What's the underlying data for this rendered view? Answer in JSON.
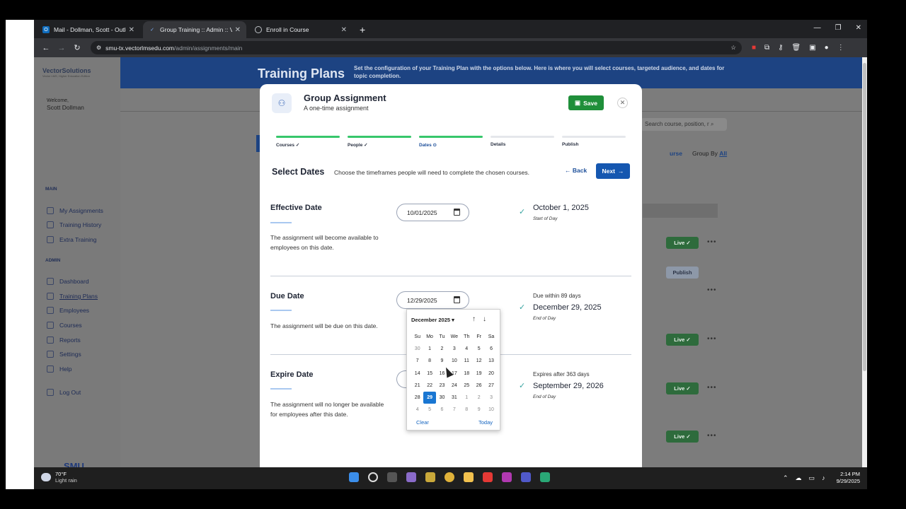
{
  "browser": {
    "tabs": [
      {
        "title": "Mail - Dollman, Scott - Outlook",
        "active": false
      },
      {
        "title": "Group Training :: Admin :: Vecto",
        "active": true
      },
      {
        "title": "Enroll in Course",
        "active": false
      }
    ],
    "url_domain": "smu-tx.vectorlmsedu.com",
    "url_path": "/admin/assignments/main"
  },
  "sidebar": {
    "logo": "VectorSolutions",
    "logo_sub": "Vector LMS, Higher Education Edition",
    "welcome": "Welcome,",
    "user": "Scott Dollman",
    "main_label": "MAIN",
    "main_items": [
      "My Assignments",
      "Training History",
      "Extra Training"
    ],
    "admin_label": "ADMIN",
    "admin_items": [
      "Dashboard",
      "Training Plans",
      "Employees",
      "Courses",
      "Reports",
      "Settings",
      "Help"
    ],
    "logout": "Log Out",
    "footer_logo": "SMU"
  },
  "banner": {
    "title": "Training Plans",
    "description": "Set the configuration of your Training Plan with the options below. Here is where you will select courses, targeted audience, and dates for topic completion."
  },
  "background": {
    "search_placeholder": "Search course, position, r",
    "sort_fragment": "urse",
    "group_by_label": "Group By",
    "group_by_value": "All",
    "badge_live": "Live ✓",
    "badge_publish": "Publish"
  },
  "modal": {
    "title": "Group Assignment",
    "subtitle": "A one-time assignment",
    "save_label": "Save",
    "steps": [
      {
        "label": "Courses ✓",
        "done": true
      },
      {
        "label": "People ✓",
        "done": true
      },
      {
        "label": "Dates ⊙",
        "done": true
      },
      {
        "label": "Details",
        "done": false
      },
      {
        "label": "Publish",
        "done": false
      }
    ],
    "section_title": "Select Dates",
    "section_desc": "Choose the timeframes people will need to complete the chosen courses.",
    "back_label": "Back",
    "next_label": "Next",
    "effective": {
      "title": "Effective Date",
      "desc": "The assignment will become available to employees on this date.",
      "input": "10/01/2025",
      "result": "October 1, 2025",
      "result_sub": "Start of Day"
    },
    "due": {
      "title": "Due Date",
      "desc": "The assignment will be due on this date.",
      "input": "12/29/2025",
      "result_pre": "Due within 89 days",
      "result": "December 29, 2025",
      "result_sub": "End of Day"
    },
    "expire": {
      "title": "Expire Date",
      "desc": "The assignment will no longer be available for employees after this date.",
      "result_pre": "Expires after 363 days",
      "result": "September 29, 2026",
      "result_sub": "End of Day"
    }
  },
  "calendar": {
    "month": "December 2025 ▾",
    "weekdays": [
      "Su",
      "Mo",
      "Tu",
      "We",
      "Th",
      "Fr",
      "Sa"
    ],
    "days": [
      "30",
      "1",
      "2",
      "3",
      "4",
      "5",
      "6",
      "7",
      "8",
      "9",
      "10",
      "11",
      "12",
      "13",
      "14",
      "15",
      "16",
      "17",
      "18",
      "19",
      "20",
      "21",
      "22",
      "23",
      "24",
      "25",
      "26",
      "27",
      "28",
      "29",
      "30",
      "31",
      "1",
      "2",
      "3",
      "4",
      "5",
      "6",
      "7",
      "8",
      "9",
      "10"
    ],
    "selected": "29",
    "clear_label": "Clear",
    "today_label": "Today"
  },
  "taskbar": {
    "temp": "70°F",
    "weather": "Light rain",
    "time": "2:14 PM",
    "date": "9/29/2025"
  }
}
